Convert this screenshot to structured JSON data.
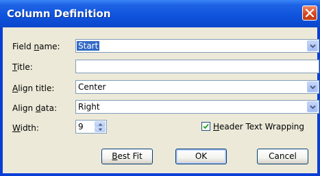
{
  "dialog": {
    "title": "Column Definition"
  },
  "form": {
    "field_name": {
      "label_prefix": "Field ",
      "label_access": "n",
      "label_suffix": "ame:",
      "value": "Start"
    },
    "title": {
      "label_access": "T",
      "label_suffix": "itle:",
      "value": ""
    },
    "align_title": {
      "label_access": "A",
      "label_suffix": "lign title:",
      "value": "Center"
    },
    "align_data": {
      "label_prefix": "Align ",
      "label_access": "d",
      "label_suffix": "ata:",
      "value": "Right"
    },
    "width": {
      "label_access": "W",
      "label_suffix": "idth:",
      "value": "9"
    },
    "header_wrap": {
      "checked": true,
      "label_access": "H",
      "label_suffix": "eader Text Wrapping"
    }
  },
  "buttons": {
    "best_fit": {
      "access": "B",
      "suffix": "est Fit"
    },
    "ok": {
      "label": "OK"
    },
    "cancel": {
      "label": "Cancel"
    }
  },
  "icons": {
    "close": "close-icon",
    "dropdown": "chevron-down-icon",
    "spin_up": "chevron-up-icon",
    "spin_down": "chevron-down-icon",
    "check": "check-icon"
  },
  "colors": {
    "titlebar": "#0a47cc",
    "close_button": "#d8471f",
    "selection": "#316ac5",
    "dialog_face": "#ece9d8"
  }
}
